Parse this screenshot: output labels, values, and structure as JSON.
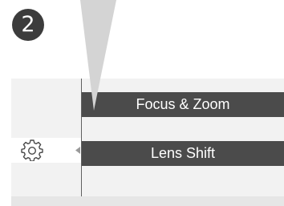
{
  "step": {
    "number": "2"
  },
  "menu": {
    "items": [
      {
        "label": "Focus & Zoom"
      },
      {
        "label": "Lens Shift"
      }
    ]
  },
  "icons": {
    "settings": "gear-icon",
    "pointer": "callout-pointer",
    "caret": "caret-left-icon"
  },
  "colors": {
    "badge": "#3c3c3c",
    "menu_item": "#4b4b4b",
    "panel": "#f2f2f2",
    "pointer": "#d4d4d4"
  }
}
